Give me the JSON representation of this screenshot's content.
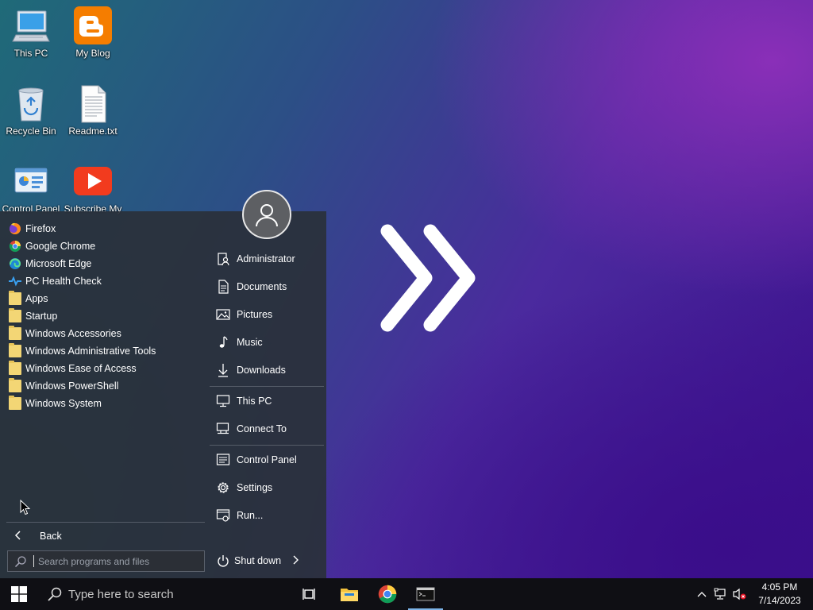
{
  "desktop": {
    "icons": [
      {
        "label": "This PC",
        "icon": "computer-icon"
      },
      {
        "label": "My Blog",
        "icon": "blogger-icon"
      },
      {
        "label": "Recycle Bin",
        "icon": "recycle-bin-icon"
      },
      {
        "label": "Readme.txt",
        "icon": "text-file-icon"
      },
      {
        "label": "Control Panel",
        "icon": "control-panel-icon"
      },
      {
        "label": "Subscribe My",
        "icon": "youtube-icon"
      }
    ]
  },
  "start_menu": {
    "programs": [
      {
        "label": "Firefox",
        "icon": "firefox-icon"
      },
      {
        "label": "Google Chrome",
        "icon": "chrome-icon"
      },
      {
        "label": "Microsoft Edge",
        "icon": "edge-icon"
      },
      {
        "label": "PC Health Check",
        "icon": "health-check-icon"
      },
      {
        "label": "Apps",
        "icon": "folder-icon"
      },
      {
        "label": "Startup",
        "icon": "folder-icon"
      },
      {
        "label": "Windows Accessories",
        "icon": "folder-icon"
      },
      {
        "label": "Windows Administrative Tools",
        "icon": "folder-icon"
      },
      {
        "label": "Windows Ease of Access",
        "icon": "folder-icon"
      },
      {
        "label": "Windows PowerShell",
        "icon": "folder-icon"
      },
      {
        "label": "Windows System",
        "icon": "folder-icon"
      }
    ],
    "back_label": "Back",
    "search_placeholder": "Search programs and files",
    "right_items": [
      {
        "label": "Administrator",
        "icon": "user-folder-icon"
      },
      {
        "label": "Documents",
        "icon": "documents-icon"
      },
      {
        "label": "Pictures",
        "icon": "pictures-icon"
      },
      {
        "label": "Music",
        "icon": "music-icon"
      },
      {
        "label": "Downloads",
        "icon": "download-icon"
      },
      {
        "label": "This PC",
        "icon": "monitor-icon"
      },
      {
        "label": "Connect To",
        "icon": "connect-icon"
      },
      {
        "label": "Control Panel",
        "icon": "control-panel-icon"
      },
      {
        "label": "Settings",
        "icon": "gear-icon"
      },
      {
        "label": "Run...",
        "icon": "run-icon"
      }
    ],
    "shutdown_label": "Shut down"
  },
  "taskbar": {
    "search_placeholder": "Type here to search",
    "clock_time": "4:05 PM",
    "clock_date": "7/14/2023"
  },
  "colors": {
    "menu_bg": "#2a303a",
    "taskbar_bg": "#0f0f14",
    "folder": "#f3d675",
    "accent_underline": "#7db4e8"
  }
}
